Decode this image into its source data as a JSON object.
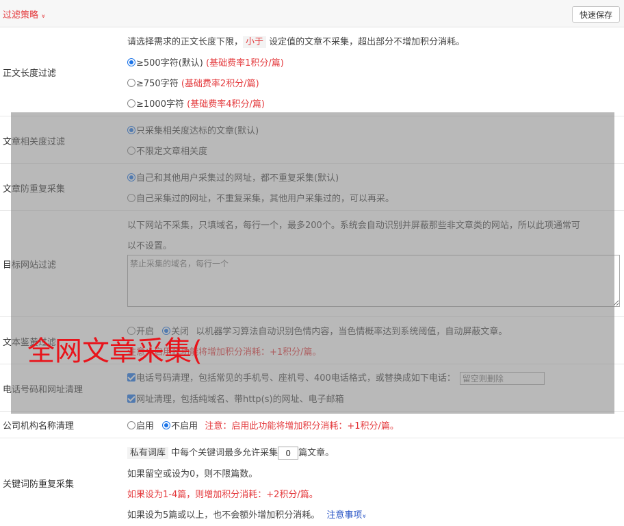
{
  "header": {
    "title": "过滤策略",
    "chevron": "»",
    "save_label": "快速保存"
  },
  "length_filter": {
    "label": "正文长度过滤",
    "desc_before": "请选择需求的正文长度下限，",
    "desc_tag": "小于",
    "desc_after": "设定值的文章不采集，超出部分不增加积分消耗。",
    "options": [
      {
        "text": "≥500字符(默认)",
        "note": "(基础费率1积分/篇)",
        "checked": true
      },
      {
        "text": "≥750字符",
        "note": "(基础费率2积分/篇)",
        "checked": false
      },
      {
        "text": "≥1000字符",
        "note": "(基础费率4积分/篇)",
        "checked": false
      }
    ]
  },
  "relevance": {
    "label": "文章相关度过滤",
    "options": [
      {
        "text": "只采集相关度达标的文章(默认)",
        "checked": true
      },
      {
        "text": "不限定文章相关度",
        "checked": false
      }
    ]
  },
  "dedup": {
    "label": "文章防重复采集",
    "options": [
      {
        "text": "自己和其他用户采集过的网址，都不重复采集(默认)",
        "checked": true
      },
      {
        "text": "自己采集过的网址，不重复采集，其他用户采集过的，可以再采。",
        "checked": false
      }
    ]
  },
  "site_filter": {
    "label": "目标网站过滤",
    "desc1": "以下网站不采集，只填域名，每行一个，最多200个。系统会自动识别并屏蔽那些非文章类的网站，所以此项通常可",
    "desc2": "以不设置。",
    "placeholder": "禁止采集的域名，每行一个"
  },
  "text_review": {
    "label": "文本鉴黄过滤",
    "on": "开启",
    "off": "关闭",
    "desc": "以机器学习算法自动识别色情内容，当色情概率达到系统阈值，自动屏蔽文章。",
    "note": "注意：启用此功能将增加积分消耗：+1积分/篇。"
  },
  "phone_url": {
    "label": "电话号码和网址清理",
    "phone_text": "电话号码清理，包括常见的手机号、座机号、400电话格式，或替换成如下电话：",
    "phone_placeholder": "留空则删除",
    "url_text": "网址清理，包括纯域名、带http(s)的网址、电子邮箱"
  },
  "org_name": {
    "label": "公司机构名称清理",
    "on": "启用",
    "off": "不启用",
    "note": "注意：启用此功能将增加积分消耗：+1积分/篇。"
  },
  "keyword_dedup": {
    "label": "关键词防重复采集",
    "tag": "私有词库",
    "line1_a": "中每个关键词最多允许采集",
    "value": "0",
    "line1_b": "篇文章。",
    "line2": "如果留空或设为0，则不限篇数。",
    "line3": "如果设为1-4篇，则增加积分消耗：+2积分/篇。",
    "line4": "如果设为5篇或以上，也不会额外增加积分消耗。",
    "link": "注意事项",
    "link_chevron": "»"
  },
  "watermark": "全网文章采集("
}
